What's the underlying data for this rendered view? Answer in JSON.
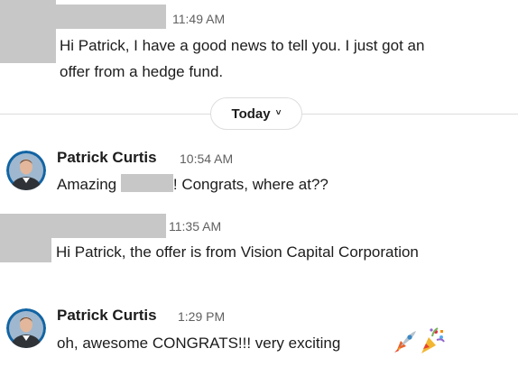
{
  "messages": [
    {
      "time": "11:49 AM",
      "line1": "Hi Patrick, I have a good news to tell you. I just got an",
      "line2": "offer from a hedge fund."
    },
    {
      "sender": "Patrick Curtis",
      "time": "10:54 AM",
      "text_before": "Amazing ",
      "text_after": "! Congrats, where at??"
    },
    {
      "time": "11:35 AM",
      "text": "Hi Patrick, the offer is from Vision Capital Corporation"
    },
    {
      "sender": "Patrick Curtis",
      "time": "1:29 PM",
      "text": "oh, awesome CONGRATS!!!  very exciting",
      "emojis": [
        "rocket-icon",
        "party-popper-icon"
      ]
    }
  ],
  "divider": {
    "label": "Today",
    "chevron": "˅"
  },
  "colors": {
    "text": "#1d1c1d",
    "timestamp": "#616061",
    "divider": "#dddddd",
    "redaction": "#c7c7c7",
    "avatar_ring": "#1264a3"
  }
}
